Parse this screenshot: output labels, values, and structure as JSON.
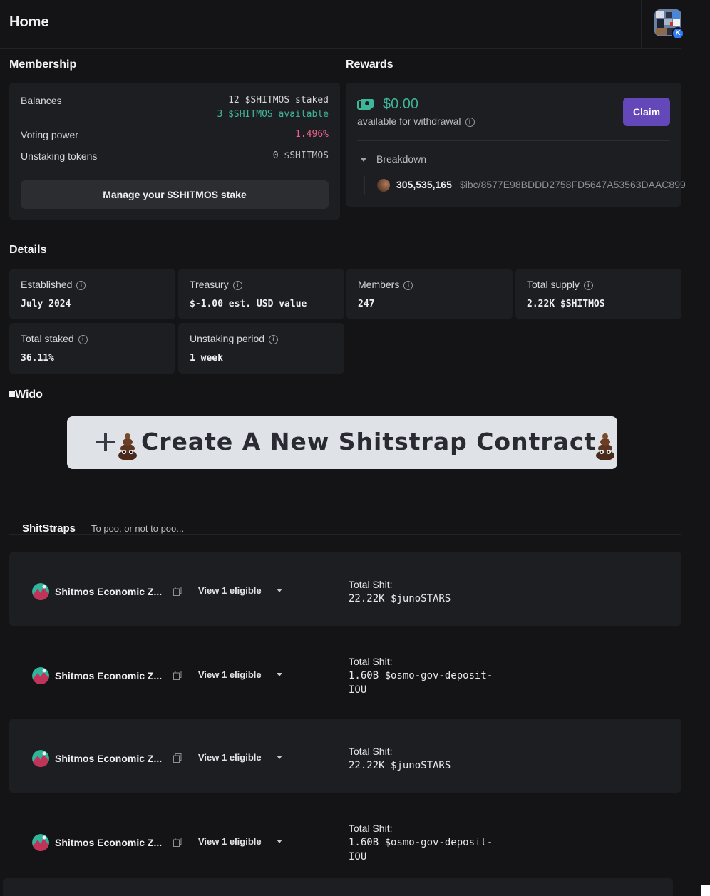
{
  "header": {
    "title": "Home",
    "avatar_badge": "K"
  },
  "membership": {
    "title": "Membership",
    "balances_label": "Balances",
    "staked": "12 $SHITMOS staked",
    "available": "3 $SHITMOS available",
    "voting_power_label": "Voting power",
    "voting_power": "1.496%",
    "unstaking_label": "Unstaking tokens",
    "unstaking": "0 $SHITMOS",
    "manage_button": "Manage your $SHITMOS stake"
  },
  "rewards": {
    "title": "Rewards",
    "amount": "$0.00",
    "subtitle": "available for withdrawal",
    "claim_button": "Claim",
    "breakdown_label": "Breakdown",
    "breakdown_amount": "305,535,165",
    "breakdown_denom": "$ibc/8577E98BDDD2758FD5647A53563DAAC899"
  },
  "details": {
    "title": "Details",
    "items": [
      {
        "label": "Established",
        "value": "July 2024"
      },
      {
        "label": "Treasury",
        "value": "$-1.00 est. USD value"
      },
      {
        "label": "Members",
        "value": "247"
      },
      {
        "label": "Total supply",
        "value": "2.22K $SHITMOS"
      },
      {
        "label": "Total staked",
        "value": "36.11%"
      },
      {
        "label": "Unstaking period",
        "value": "1 week"
      }
    ]
  },
  "widgets": {
    "title": "Wido"
  },
  "banner": {
    "text": "Create A New Shitstrap Contract"
  },
  "shitstraps": {
    "tab_label": "ShitStraps",
    "tab_subtitle": "To poo, or not to poo...",
    "items": [
      {
        "name": "Shitmos Economic Z...",
        "eligible": "View 1 eligible",
        "total_label": "Total Shit:",
        "total_value": "22.22K $junoSTARS"
      },
      {
        "name": "Shitmos Economic Z...",
        "eligible": "View 1 eligible",
        "total_label": "Total Shit:",
        "total_value": "1.60B $osmo-gov-deposit-IOU"
      },
      {
        "name": "Shitmos Economic Z...",
        "eligible": "View 1 eligible",
        "total_label": "Total Shit:",
        "total_value": "22.22K $junoSTARS"
      },
      {
        "name": "Shitmos Economic Z...",
        "eligible": "View 1 eligible",
        "total_label": "Total Shit:",
        "total_value": "1.60B $osmo-gov-deposit-IOU"
      }
    ]
  },
  "colors": {
    "background": "#141416",
    "card": "#1d1e21",
    "accent_green": "#3fb59a",
    "accent_pink": "#f0628a",
    "claim_purple": "#6447b8"
  }
}
